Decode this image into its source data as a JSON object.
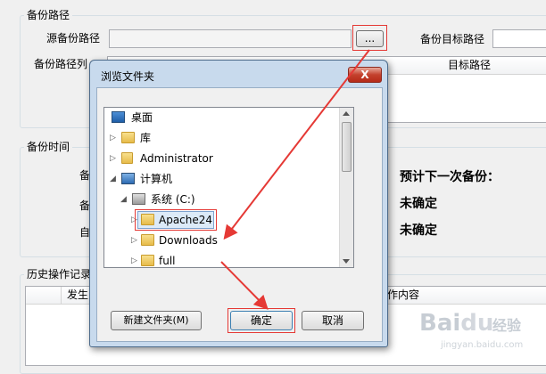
{
  "backup_path": {
    "group_title": "备份路径",
    "source_label": "源备份路径",
    "browse_label": "...",
    "target_label": "备份目标路径",
    "list_label": "备份路径列",
    "target_col": "目标路径"
  },
  "backup_time": {
    "group_title": "备份时间",
    "row_prefixes": [
      "备",
      "备",
      "自"
    ],
    "next_label": "预计下一次备份：",
    "value1": "未确定",
    "value2": "未确定"
  },
  "history": {
    "group_title": "历史操作记录",
    "columns": [
      "发生",
      "作内容"
    ]
  },
  "dialog": {
    "title": "浏览文件夹",
    "close_label": "X",
    "tree": [
      {
        "label": "桌面",
        "icon": "desktop-icon",
        "toggle": ""
      },
      {
        "label": "库",
        "icon": "library-icon",
        "toggle": "▷"
      },
      {
        "label": "Administrator",
        "icon": "user-folder-icon",
        "toggle": "▷"
      },
      {
        "label": "计算机",
        "icon": "computer-icon",
        "toggle": "◢"
      },
      {
        "label": "系统 (C:)",
        "icon": "drive-icon",
        "toggle": "◢"
      },
      {
        "label": "Apache24",
        "icon": "folder-icon",
        "toggle": "▷",
        "selected": true
      },
      {
        "label": "Downloads",
        "icon": "folder-icon",
        "toggle": "▷"
      },
      {
        "label": "full",
        "icon": "folder-icon",
        "toggle": "▷"
      }
    ],
    "new_folder_label": "新建文件夹(M)",
    "ok_label": "确定",
    "cancel_label": "取消"
  },
  "watermark": "Baidu 经验 jingyan.baidu.com",
  "annotation_color": "#e53935"
}
